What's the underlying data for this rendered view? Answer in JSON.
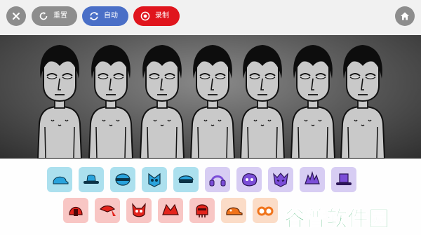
{
  "toolbar": {
    "reset_label": "重置",
    "auto_label": "自动",
    "record_label": "录制",
    "colors": {
      "neutral": "#8d8d8d",
      "auto": "#4a6fc7",
      "record": "#e0151d"
    }
  },
  "stage": {
    "character_count": 7,
    "background": "#5c5c5c"
  },
  "palette": {
    "row1": [
      {
        "icon": "blue-cap-icon",
        "color": "#29a3dc"
      },
      {
        "icon": "fedora-hat-icon",
        "color": "#29a3dc"
      },
      {
        "icon": "headband-icon",
        "color": "#29a3dc"
      },
      {
        "icon": "mask-icon",
        "color": "#29a3dc"
      },
      {
        "icon": "visor-icon",
        "color": "#29a3dc"
      },
      {
        "icon": "headphones-icon",
        "color": "#7b4ed8"
      },
      {
        "icon": "blob-face-icon",
        "color": "#7b4ed8"
      },
      {
        "icon": "spiky-mask-icon",
        "color": "#7b4ed8"
      },
      {
        "icon": "spiky-hat-icon",
        "color": "#7b4ed8"
      },
      {
        "icon": "tophat-icon",
        "color": "#7b4ed8"
      }
    ],
    "row2": [
      {
        "icon": "red-helmet-icon",
        "color": "#e3241c"
      },
      {
        "icon": "bandana-icon",
        "color": "#e3241c"
      },
      {
        "icon": "devil-mask-icon",
        "color": "#e3241c"
      },
      {
        "icon": "horned-hat-icon",
        "color": "#e3241c"
      },
      {
        "icon": "skull-mask-icon",
        "color": "#e3241c"
      },
      {
        "icon": "orange-cap-icon",
        "color": "#f0731a"
      },
      {
        "icon": "goggles-icon",
        "color": "#f0731a"
      }
    ]
  },
  "watermark": {
    "text": "谷普软件园",
    "color": "#1aa152"
  }
}
